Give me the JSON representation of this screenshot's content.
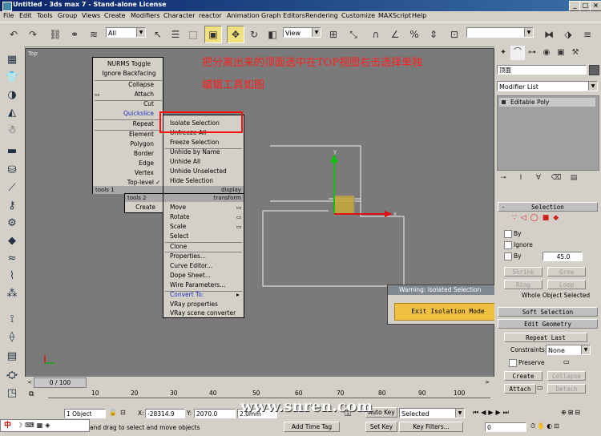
{
  "window": {
    "title": "Untitled - 3ds max 7 - Stand-alone License"
  },
  "menus": [
    "File",
    "Edit",
    "Tools",
    "Group",
    "Views",
    "Create",
    "Modifiers",
    "Character",
    "reactor",
    "Animation",
    "Graph Editors",
    "Rendering",
    "Customize",
    "MAXScript",
    "Help"
  ],
  "toolbar": {
    "selection_filter": "All",
    "ref_coord": "View",
    "named_sel": ""
  },
  "viewport": {
    "label": "Top",
    "annotation_line1": "把分离出来的顶面选中在TOP视图右击选择单独",
    "annotation_line2": "编辑工具如图"
  },
  "quad_menu": {
    "tools1": {
      "items": [
        "NURMS Toggle",
        "Ignore Backfacing",
        "Collapse",
        "Attach",
        "Cut",
        "Quickslice",
        "Repeat",
        "Element",
        "Polygon",
        "Border",
        "Edge",
        "Vertex",
        "Top-level"
      ],
      "footer": "tools 1"
    },
    "display": {
      "items": [
        "Isolate Selection",
        "Unfreeze All",
        "Freeze Selection",
        "Unhide by Name",
        "Unhide All",
        "Unhide Unselected",
        "Hide Selection"
      ],
      "footer": "display"
    },
    "tools2": {
      "header": "tools 2",
      "items": [
        "Create"
      ]
    },
    "transform": {
      "header": "transform",
      "items": [
        "Move",
        "Rotate",
        "Scale",
        "Select",
        "Clone",
        "Properties...",
        "Curve Editor...",
        "Dope Sheet...",
        "Wire Parameters...",
        "Convert To:",
        "VRay properties",
        "VRay scene converter"
      ]
    }
  },
  "warning_dialog": {
    "title": "Warning: Isolated Selection",
    "button": "Exit Isolation Mode"
  },
  "command_panel": {
    "object_name": "顶面",
    "modifier_list": "Modifier List",
    "stack_item": "Editable Poly",
    "selection_rollout": {
      "title": "Selection",
      "by_vertex": "By",
      "ignore_backfacing": "Ignore",
      "by_angle": "By",
      "angle_value": "45.0",
      "shrink": "Shrink",
      "grow": "Grow",
      "ring": "Ring",
      "loop": "Loop",
      "status": "Whole Object Selected"
    },
    "soft_selection": "Soft Selection",
    "edit_geometry": "Edit Geometry",
    "repeat_last": "Repeat Last",
    "constraints_label": "Constraints:",
    "constraints_value": "None",
    "preserve": "Preserve",
    "create": "Create",
    "collapse": "Collapse",
    "attach": "Attach",
    "detach": "Detach"
  },
  "timeline": {
    "frame": "0 / 100",
    "ticks": [
      "10",
      "20",
      "30",
      "40",
      "50",
      "60",
      "70",
      "80",
      "90",
      "100"
    ]
  },
  "status_bar": {
    "objects": "1 Object",
    "x_label": "X:",
    "x_value": "-28314.9",
    "y_label": "Y:",
    "y_value": "2070.0",
    "z_value": "2.0mm",
    "prompt": "and drag to select and move objects",
    "add_time_tag": "Add Time Tag",
    "auto_key": "Auto Key",
    "set_key": "Set Key",
    "selected": "Selected",
    "key_filters": "Key Filters...",
    "frame_value": "0"
  },
  "watermark": "www.snren.com",
  "ime": "中"
}
